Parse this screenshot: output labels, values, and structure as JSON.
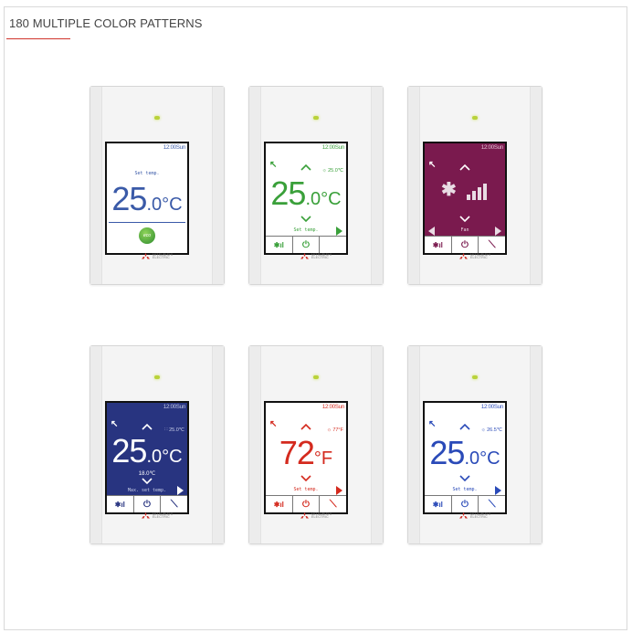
{
  "page": {
    "heading": "180 MULTIPLE COLOR PATTERNS",
    "brand_logo_text": [
      "MITSUBISHI",
      "ELECTRIC"
    ]
  },
  "colors": {
    "accent_red": "#d0342c",
    "blue_text": "#3a5aa8",
    "green_text": "#3aa03a",
    "purple_bg": "#7a1a4e",
    "navy_bg": "#283480",
    "red_text": "#d42a1e"
  },
  "devices": [
    {
      "theme": "white-blue",
      "clock": "12:00Sun",
      "set_temp_label": "Set temp.",
      "temp_whole": "25",
      "temp_decimal": ".0",
      "temp_unit": "°C",
      "icon": "eco-changes-icon",
      "eco_text": "eco"
    },
    {
      "theme": "white-green",
      "clock": "12:00Sun",
      "side_value": "☼ 25.0℃",
      "temp_whole": "25",
      "temp_decimal": ".0",
      "temp_unit": "°C",
      "bottom_label": "Set temp.",
      "dots": "● ● ●"
    },
    {
      "theme": "purple",
      "clock": "12:00Sun",
      "fan_label": "Fan",
      "dots": "● ● ● ● ● ●"
    },
    {
      "theme": "navy",
      "clock": "12:00Sun",
      "side_value": "∷ 25.0℃",
      "temp_whole": "25",
      "temp_decimal": ".0",
      "temp_unit": "°C",
      "sub_value": "18.0℃",
      "bottom_label": "Max. set temp.",
      "dots": "● ● ● ● ● ●"
    },
    {
      "theme": "white-red",
      "clock": "12:00Sun",
      "side_value": "☼ 77°F",
      "temp_whole": "72",
      "temp_decimal": "",
      "temp_unit": "°F",
      "bottom_label": "Set temp.",
      "dots": "● ● ● ● ● ●"
    },
    {
      "theme": "white-blue",
      "clock": "12:00Sun",
      "side_value": "☼ 26.5℃",
      "temp_whole": "25",
      "temp_decimal": ".0",
      "temp_unit": "°C",
      "bottom_label": "Set temp.",
      "dots": "● ● ● ● ● ●"
    }
  ]
}
